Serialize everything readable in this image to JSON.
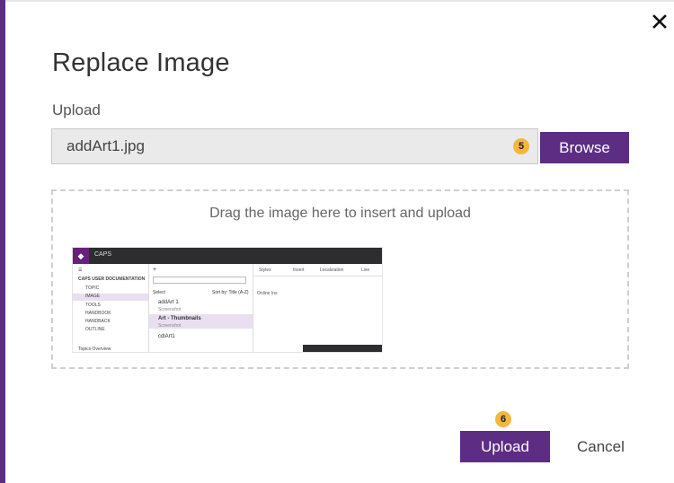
{
  "dialog": {
    "title": "Replace Image",
    "upload_label": "Upload",
    "file_value": "addArt1.jpg",
    "browse_label": "Browse",
    "drop_text": "Drag the image here to insert and upload",
    "upload_button": "Upload",
    "cancel_button": "Cancel",
    "callouts": [
      "5",
      "6"
    ]
  },
  "preview": {
    "app_name": "CAPS",
    "sidebar": [
      "CAPS USER DOCUMENTATION",
      "TOPIC",
      "IMAGE",
      "TOOLS",
      "HANDBOOK",
      "HANDBACK",
      "OUTLINE",
      "Topics Overview"
    ],
    "list": [
      "Select",
      "Sort by: Title (A-Z)",
      "addArt 1",
      "Screenshot",
      "Art - Thumbnails",
      "Screenshot",
      "cdlArt1"
    ],
    "toolbar": [
      "Styles",
      "Insert",
      "Localization",
      "Live"
    ],
    "content": "Online Ins"
  },
  "colors": {
    "accent": "#5c2d82",
    "callout": "#f4b63f"
  }
}
